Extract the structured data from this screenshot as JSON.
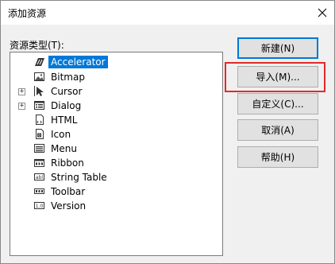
{
  "dialog": {
    "title": "添加资源",
    "close_glyph": "✕"
  },
  "resource_types": {
    "label": "资源类型(T):",
    "items": [
      {
        "label": "Accelerator",
        "icon": "accelerator-icon",
        "selected": true,
        "expandable": false
      },
      {
        "label": "Bitmap",
        "icon": "bitmap-icon",
        "selected": false,
        "expandable": false
      },
      {
        "label": "Cursor",
        "icon": "cursor-icon",
        "selected": false,
        "expandable": true
      },
      {
        "label": "Dialog",
        "icon": "dialog-icon",
        "selected": false,
        "expandable": true
      },
      {
        "label": "HTML",
        "icon": "html-icon",
        "selected": false,
        "expandable": false
      },
      {
        "label": "Icon",
        "icon": "icon-resource-icon",
        "selected": false,
        "expandable": false
      },
      {
        "label": "Menu",
        "icon": "menu-icon",
        "selected": false,
        "expandable": false
      },
      {
        "label": "Ribbon",
        "icon": "ribbon-icon",
        "selected": false,
        "expandable": false
      },
      {
        "label": "String Table",
        "icon": "string-table-icon",
        "selected": false,
        "expandable": false
      },
      {
        "label": "Toolbar",
        "icon": "toolbar-icon",
        "selected": false,
        "expandable": false
      },
      {
        "label": "Version",
        "icon": "version-icon",
        "selected": false,
        "expandable": false
      }
    ],
    "expander_glyph": "+"
  },
  "buttons": {
    "new": "新建(N)",
    "import": "导入(M)...",
    "custom": "自定义(C)...",
    "cancel": "取消(A)",
    "help": "帮助(H)"
  },
  "colors": {
    "selection": "#0078d7",
    "highlight_box": "#e02b2b"
  }
}
